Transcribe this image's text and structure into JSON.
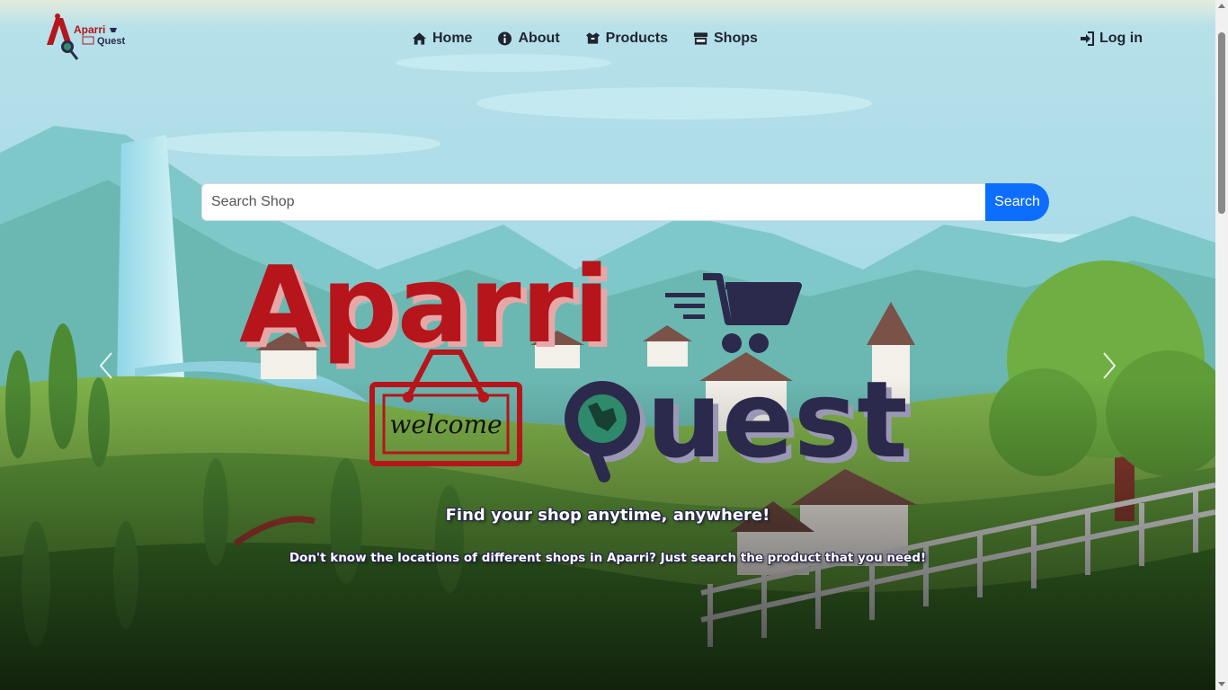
{
  "brand": {
    "line1": "Aparri",
    "line2": "Quest"
  },
  "nav": {
    "home": {
      "label": "Home",
      "icon": "home-icon"
    },
    "about": {
      "label": "About",
      "icon": "info-circle-icon"
    },
    "products": {
      "label": "Products",
      "icon": "boxes-icon"
    },
    "shops": {
      "label": "Shops",
      "icon": "store-icon"
    },
    "login": {
      "label": "Log in",
      "icon": "sign-in-icon"
    }
  },
  "search": {
    "placeholder": "Search Shop",
    "value": "",
    "button_label": "Search"
  },
  "hero": {
    "logo_word1": "Aparri",
    "logo_word2": "Quest",
    "sign_text": "welcome",
    "tagline": "Find your shop anytime, anywhere!",
    "subtagline": "Don't know the locations of different shops in Aparri? Just search the product that you need!"
  },
  "colors": {
    "brand_red": "#b5151b",
    "brand_navy": "#2b2a4c",
    "button_blue": "#0d6efd"
  }
}
